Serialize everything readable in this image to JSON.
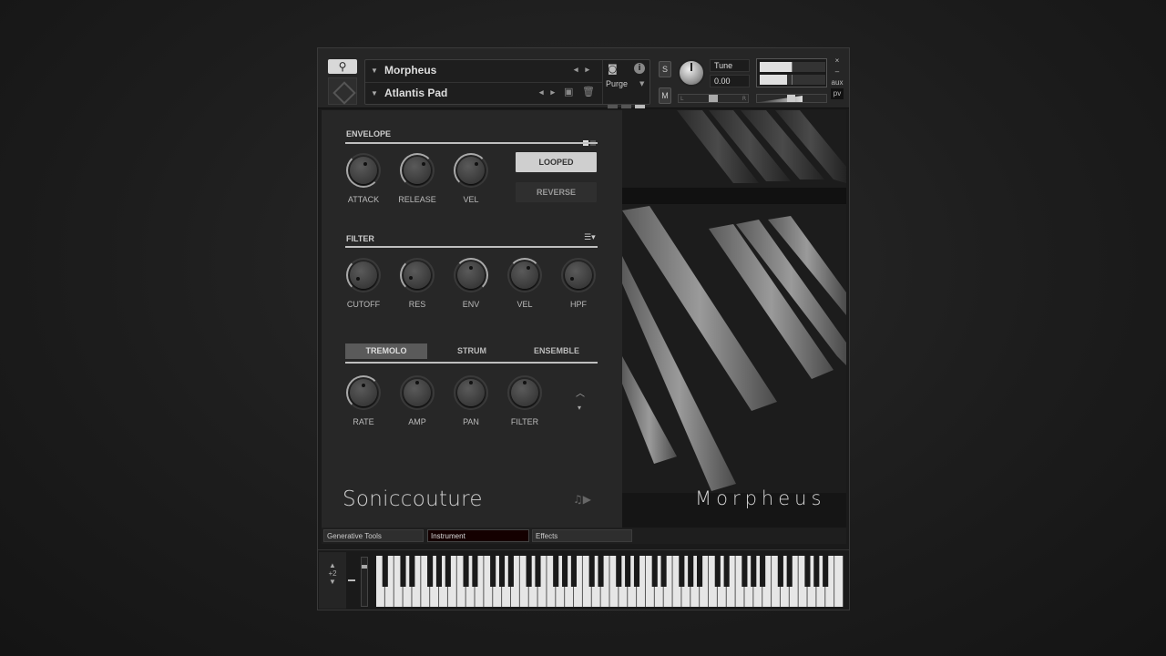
{
  "header": {
    "instrument_name": "Morpheus",
    "snapshot_name": "Atlantis Pad",
    "purge_label": "Purge",
    "s_label": "S",
    "m_label": "M",
    "tune_label": "Tune",
    "tune_value": "0.00",
    "pan_left": "L",
    "pan_right": "R",
    "close": "×",
    "minimize": "–",
    "aux": "aux",
    "pv": "pv",
    "volume_level": 0.48
  },
  "envelope": {
    "title": "ENVELOPE",
    "knobs": [
      {
        "label": "ATTACK"
      },
      {
        "label": "RELEASE"
      },
      {
        "label": "VEL"
      }
    ],
    "looped_label": "LOOPED",
    "reverse_label": "REVERSE"
  },
  "filter": {
    "title": "FILTER",
    "knobs": [
      {
        "label": "CUTOFF"
      },
      {
        "label": "RES"
      },
      {
        "label": "ENV"
      },
      {
        "label": "VEL"
      },
      {
        "label": "HPF"
      }
    ]
  },
  "modulation": {
    "tabs": [
      "TREMOLO",
      "STRUM",
      "ENSEMBLE"
    ],
    "knobs": [
      {
        "label": "RATE"
      },
      {
        "label": "AMP"
      },
      {
        "label": "PAN"
      },
      {
        "label": "FILTER"
      }
    ]
  },
  "branding": {
    "company": "Soniccouture",
    "product": "Morpheus"
  },
  "bottom_tabs": [
    "Generative Tools",
    "Instrument",
    "Effects"
  ],
  "keyboard": {
    "octave_offset": "+2"
  },
  "colors": {
    "background": "#1d1d1d",
    "panel": "#272727",
    "accent_button": "#cfcfcf"
  }
}
